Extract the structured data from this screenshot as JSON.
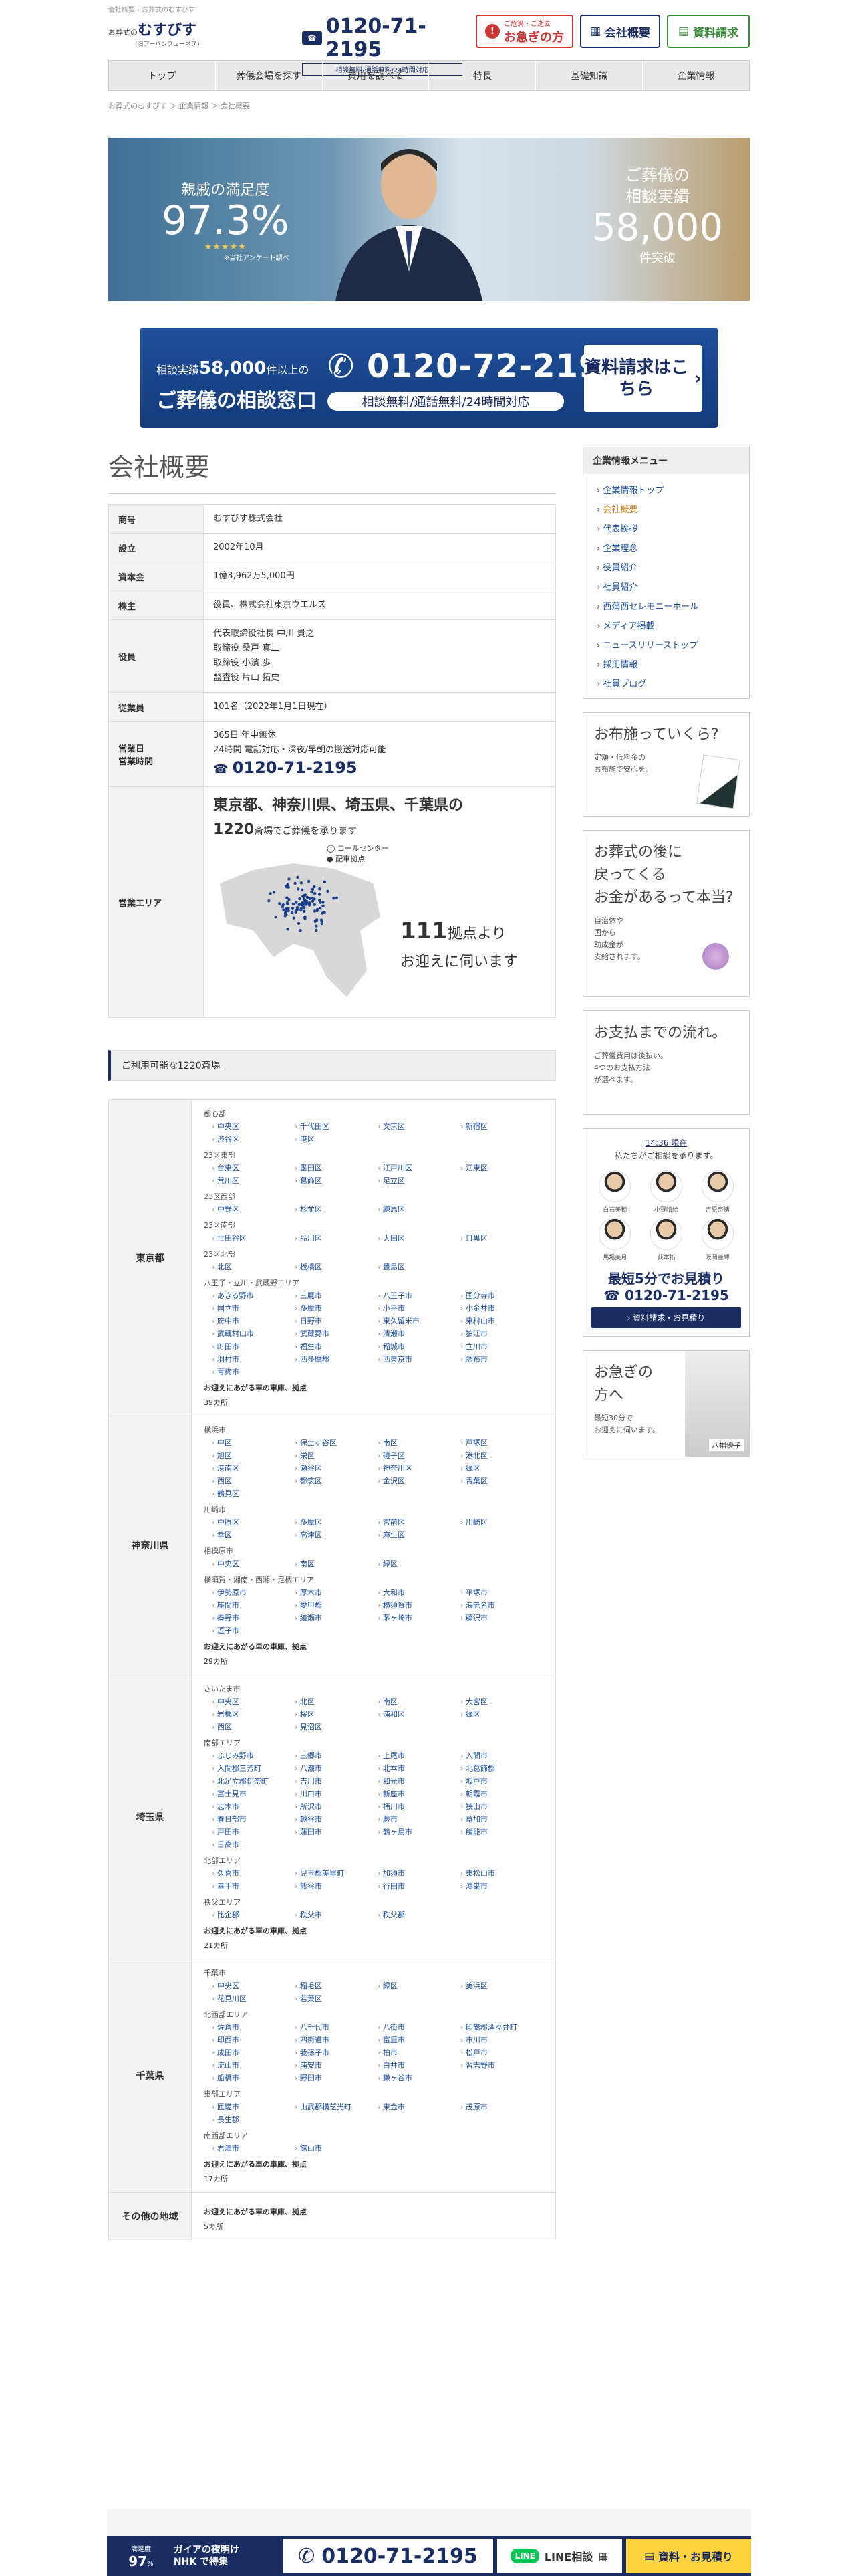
{
  "top_crumb": "会社概要 - お葬式のむすびす",
  "header": {
    "logo_small": "お葬式の",
    "logo_big": "むすびす",
    "logo_sub": "(旧アーバンフューネス)",
    "phone": "0120-71-2195",
    "phone_icon": "freedial-icon",
    "phone_note": "相談無料/通話無料/24時間対応",
    "urgent_line1": "ご危篤・ご逝去",
    "urgent_line2": "お急ぎの方",
    "company_btn": "会社概要",
    "request_btn": "資料請求"
  },
  "nav": [
    "トップ",
    "葬儀会場を探す",
    "費用を調べる",
    "特長",
    "基礎知識",
    "企業情報"
  ],
  "breadcrumb": "お葬式のむすびす ＞ 企業情報 ＞ 会社概要",
  "hero": {
    "sat_label": "親戚の満足度",
    "sat_value": "97.3%",
    "stars": "★★★★★",
    "sat_note": "※当社アンケート調べ",
    "rec_line1": "ご葬儀の",
    "rec_line2": "相談実績",
    "rec_value": "58,000",
    "rec_unit": "件突破"
  },
  "cta": {
    "label_pre": "相談実績",
    "label_num": "58,000",
    "label_post": "件以上の",
    "title": "ご葬儀の相談窓口",
    "phone": "0120-72-2195",
    "note": "相談無料/通話無料/24時間対応",
    "request": "資料請求はこちら"
  },
  "page_title": "会社概要",
  "company": [
    {
      "k": "商号",
      "v": "むすびす株式会社"
    },
    {
      "k": "設立",
      "v": "2002年10月"
    },
    {
      "k": "資本金",
      "v": "1億3,962万5,000円"
    },
    {
      "k": "株主",
      "v": "役員、株式会社東京ウエルズ"
    },
    {
      "k": "役員",
      "v": "代表取締役社長 中川 貴之\n取締役 桑戸 真二\n取締役 小濱 歩\n監査役 片山 拓史"
    },
    {
      "k": "従業員",
      "v": "101名（2022年1月1日現在）"
    }
  ],
  "business": {
    "k1": "営業日",
    "k2": "営業時間",
    "v1": "365日 年中無休",
    "v2": "24時間 電話対応・深夜/早朝の搬送対応可能",
    "phone": "0120-71-2195"
  },
  "area": {
    "k": "営業エリア",
    "headline": "東京都、神奈川県、埼玉県、千葉県の",
    "headline_small": "の",
    "count": "1220",
    "count_tail": "斎場でご葬儀を承ります",
    "legend1": "コールセンター",
    "legend2": "配車拠点",
    "bases_num": "111",
    "bases_tail": "拠点より",
    "bases_line2": "お迎えに伺います"
  },
  "usable_header": "ご利用可能な1220斎場",
  "prefs": [
    {
      "name": "東京都",
      "groups": [
        {
          "g": "都心部",
          "c": [
            "中央区",
            "千代田区",
            "文京区",
            "新宿区",
            "渋谷区",
            "港区"
          ]
        },
        {
          "g": "23区東部",
          "c": [
            "台東区",
            "墨田区",
            "江戸川区",
            "江東区",
            "荒川区",
            "葛飾区",
            "足立区"
          ]
        },
        {
          "g": "23区西部",
          "c": [
            "中野区",
            "杉並区",
            "練馬区"
          ]
        },
        {
          "g": "23区南部",
          "c": [
            "世田谷区",
            "品川区",
            "大田区",
            "目黒区"
          ]
        },
        {
          "g": "23区北部",
          "c": [
            "北区",
            "板橋区",
            "豊島区"
          ]
        },
        {
          "g": "八王子・立川・武蔵野エリア",
          "c": [
            "あきる野市",
            "三鷹市",
            "八王子市",
            "国分寺市",
            "国立市",
            "多摩市",
            "小平市",
            "小金井市",
            "府中市",
            "日野市",
            "東久留米市",
            "東村山市",
            "武蔵村山市",
            "武蔵野市",
            "清瀬市",
            "狛江市",
            "町田市",
            "福生市",
            "稲城市",
            "立川市",
            "羽村市",
            "西多摩郡",
            "西東京市",
            "調布市",
            "青梅市"
          ]
        }
      ],
      "note": "お迎えにあがる車の車庫、拠点",
      "count": "39カ所"
    },
    {
      "name": "神奈川県",
      "groups": [
        {
          "g": "横浜市",
          "c": [
            "中区",
            "保土ヶ谷区",
            "南区",
            "戸塚区",
            "旭区",
            "栄区",
            "磯子区",
            "港北区",
            "港南区",
            "瀬谷区",
            "神奈川区",
            "緑区",
            "西区",
            "都筑区",
            "金沢区",
            "青葉区",
            "鶴見区"
          ]
        },
        {
          "g": "川崎市",
          "c": [
            "中原区",
            "多摩区",
            "宮前区",
            "川崎区",
            "幸区",
            "高津区",
            "麻生区"
          ]
        },
        {
          "g": "相模原市",
          "c": [
            "中央区",
            "南区",
            "緑区"
          ]
        },
        {
          "g": "横須賀・湘南・西湘・足柄エリア",
          "c": [
            "伊勢原市",
            "厚木市",
            "大和市",
            "平塚市",
            "座間市",
            "愛甲郡",
            "横須賀市",
            "海老名市",
            "秦野市",
            "綾瀬市",
            "茅ヶ崎市",
            "藤沢市",
            "逗子市"
          ]
        }
      ],
      "note": "お迎えにあがる車の車庫、拠点",
      "count": "29カ所"
    },
    {
      "name": "埼玉県",
      "groups": [
        {
          "g": "さいたま市",
          "c": [
            "中央区",
            "北区",
            "南区",
            "大宮区",
            "岩槻区",
            "桜区",
            "浦和区",
            "緑区",
            "西区",
            "見沼区"
          ]
        },
        {
          "g": "南部エリア",
          "c": [
            "ふじみ野市",
            "三郷市",
            "上尾市",
            "入間市",
            "入間郡三芳町",
            "八潮市",
            "北本市",
            "北葛飾郡",
            "北足立郡伊奈町",
            "吉川市",
            "和光市",
            "坂戸市",
            "富士見市",
            "川口市",
            "新座市",
            "朝霞市",
            "志木市",
            "所沢市",
            "桶川市",
            "狭山市",
            "春日部市",
            "越谷市",
            "蕨市",
            "草加市",
            "戸田市",
            "蓮田市",
            "鶴ヶ島市",
            "飯能市",
            "日高市"
          ]
        },
        {
          "g": "北部エリア",
          "c": [
            "久喜市",
            "児玉郡美里町",
            "加須市",
            "東松山市",
            "幸手市",
            "熊谷市",
            "行田市",
            "鴻巣市"
          ]
        },
        {
          "g": "秩父エリア",
          "c": [
            "比企郡",
            "秩父市",
            "秩父郡"
          ]
        }
      ],
      "note": "お迎えにあがる車の車庫、拠点",
      "count": "21カ所"
    },
    {
      "name": "千葉県",
      "groups": [
        {
          "g": "千葉市",
          "c": [
            "中央区",
            "稲毛区",
            "緑区",
            "美浜区",
            "花見川区",
            "若葉区"
          ]
        },
        {
          "g": "北西部エリア",
          "c": [
            "佐倉市",
            "八千代市",
            "八街市",
            "印旛郡酒々井町",
            "印西市",
            "四街道市",
            "富里市",
            "市川市",
            "成田市",
            "我孫子市",
            "柏市",
            "松戸市",
            "流山市",
            "浦安市",
            "白井市",
            "習志野市",
            "船橋市",
            "野田市",
            "鎌ヶ谷市"
          ]
        },
        {
          "g": "東部エリア",
          "c": [
            "匝瑳市",
            "山武郡横芝光町",
            "東金市",
            "茂原市",
            "長生郡"
          ]
        },
        {
          "g": "南西部エリア",
          "c": [
            "君津市",
            "館山市"
          ]
        }
      ],
      "note": "お迎えにあがる車の車庫、拠点",
      "count": "17カ所"
    },
    {
      "name": "その他の地域",
      "groups": [],
      "note": "お迎えにあがる車の車庫、拠点",
      "count": "5カ所"
    }
  ],
  "sidebar": {
    "menu_title": "企業情報メニュー",
    "items": [
      "企業情報トップ",
      "会社概要",
      "代表挨拶",
      "企業理念",
      "役員紹介",
      "社員紹介",
      "西蒲西セレモニーホール",
      "メディア掲載",
      "ニュースリリーストップ",
      "採用情報",
      "社員ブログ"
    ],
    "current": "会社概要",
    "card1_title": "お布施っていくら?",
    "card1_sub": "定額・低料金の\nお布施で安心を。",
    "card2_title": "お葬式の後に\n戻ってくる\nお金があるって本当?",
    "card2_sub": "自治体や\n国から\n助成金が\n支給されます。",
    "card3_title": "お支払までの流れ。",
    "card3_sub": "ご葬儀費用は後払い。\n4つのお支払方法\nが選べます。",
    "staff_time": "14:36 現在",
    "staff_msg": "私たちがご相談を承ります。",
    "staff": [
      "白石美穂",
      "小野晴絵",
      "吉原奈緒",
      "馬場美月",
      "荻本拓",
      "阪岡亜輝"
    ],
    "staff_q": "最短5分でお見積り",
    "staff_phone": "0120-71-2195",
    "staff_btn": "資料請求・お見積り",
    "card4_title": "お急ぎの\n方へ",
    "card4_sub": "最短30分で\nお迎えに伺います。",
    "card4_name": "八幡優子"
  },
  "footer_bar": {
    "sat_label": "満足度",
    "sat_value": "97",
    "nhk_line1": "ガイアの夜明け",
    "nhk_line2": "NHK で特集",
    "phone": "0120-71-2195",
    "line_label": "LINE相談",
    "request_label": "資料・お見積り"
  }
}
